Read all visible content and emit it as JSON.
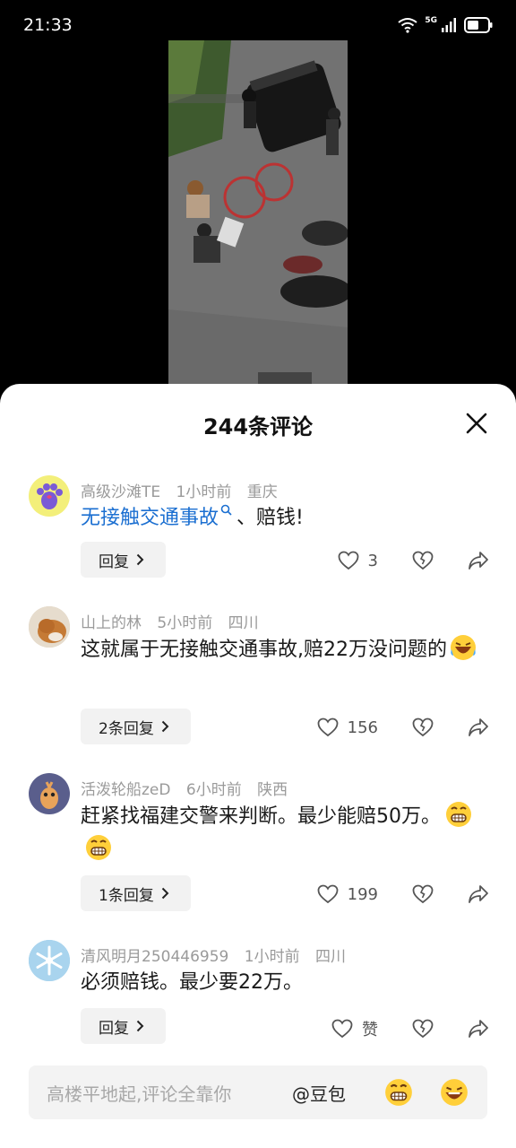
{
  "status": {
    "time": "21:33",
    "network": "5G"
  },
  "sheet": {
    "title": "244条评论"
  },
  "comments": [
    {
      "username": "高级沙滩TE",
      "time": "1小时前",
      "location": "重庆",
      "text_link": "无接触交通事故",
      "text_rest": "、赔钱!",
      "reply_label": "回复",
      "likes": "3"
    },
    {
      "username": "山上的林",
      "time": "5小时前",
      "location": "四川",
      "text": "这就属于无接触交通事故,赔22万没问题的",
      "reply_label": "2条回复",
      "likes": "156"
    },
    {
      "username": "活泼轮船zeD",
      "time": "6小时前",
      "location": "陕西",
      "text": "赶紧找福建交警来判断。最少能赔50万。",
      "reply_label": "1条回复",
      "likes": "199"
    },
    {
      "username": "清风明月250446959",
      "time": "1小时前",
      "location": "四川",
      "text": "必须赔钱。最少要22万。",
      "reply_label": "回复",
      "likes": "赞"
    }
  ],
  "composer": {
    "placeholder": "高楼平地起,评论全靠你",
    "mention": "@豆包"
  },
  "colors": {
    "link": "#1b6fd1",
    "sheet_bg": "#ffffff",
    "reply_bg": "#f2f2f2"
  }
}
